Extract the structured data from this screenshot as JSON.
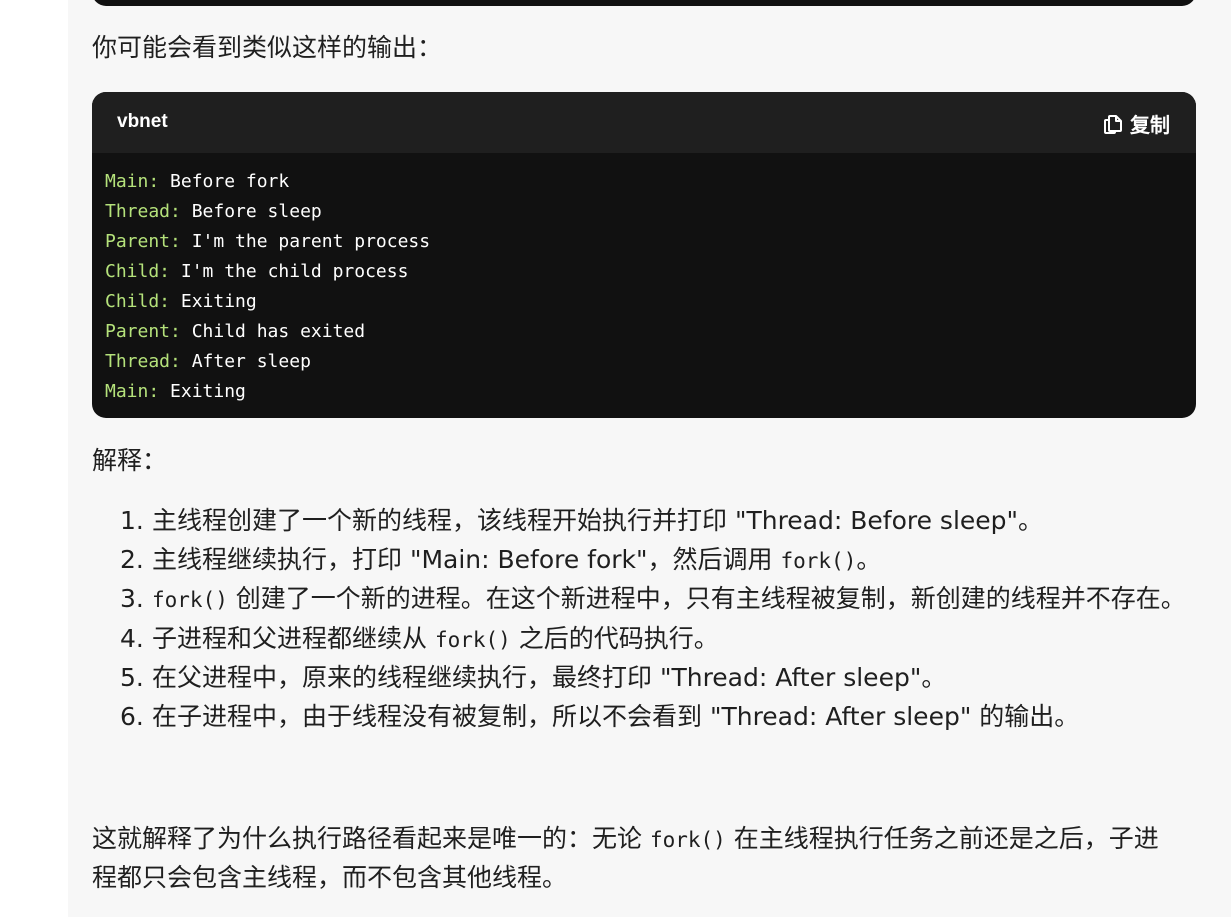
{
  "intro": "你可能会看到类似这样的输出：",
  "code": {
    "language": "vbnet",
    "copy_label": "复制",
    "lines": [
      {
        "label": "Main:",
        "text": " Before fork"
      },
      {
        "label": "Thread:",
        "text": " Before sleep"
      },
      {
        "label": "Parent:",
        "text": " I'm the parent process"
      },
      {
        "label": "Child:",
        "text": " I'm the child process"
      },
      {
        "label": "Child:",
        "text": " Exiting"
      },
      {
        "label": "Parent:",
        "text": " Child has exited"
      },
      {
        "label": "Thread:",
        "text": " After sleep"
      },
      {
        "label": "Main:",
        "text": " Exiting"
      }
    ]
  },
  "explain_heading": "解释：",
  "list": [
    {
      "num": "1.",
      "a": "主线程创建了一个新的线程，该线程开始执行并打印 \"Thread: Before sleep\"。"
    },
    {
      "num": "2.",
      "a": "主线程继续执行，打印 \"Main: Before fork\"，然后调用 ",
      "code": "fork()",
      "b": "。"
    },
    {
      "num": "3.",
      "code": "fork()",
      "b": " 创建了一个新的进程。在这个新进程中，只有主线程被复制，新创建的线程并不存在。"
    },
    {
      "num": "4.",
      "a": "子进程和父进程都继续从 ",
      "code": "fork()",
      "b": " 之后的代码执行。"
    },
    {
      "num": "5.",
      "a": "在父进程中，原来的线程继续执行，最终打印 \"Thread: After sleep\"。"
    },
    {
      "num": "6.",
      "a": "在子进程中，由于线程没有被复制，所以不会看到 \"Thread: After sleep\" 的输出。"
    }
  ],
  "conclusion": {
    "a": "这就解释了为什么执行路径看起来是唯一的：无论 ",
    "code": "fork()",
    "b": " 在主线程执行任务之前还是之后，子进程都只会包含主线程，而不包含其他线程。"
  },
  "colors": {
    "code_bg": "#111111",
    "code_header_bg": "#1f1f1f",
    "label_green": "#b5e27b",
    "panel_bg": "#f7f7f7"
  },
  "icons": {
    "copy": "copy-icon"
  }
}
